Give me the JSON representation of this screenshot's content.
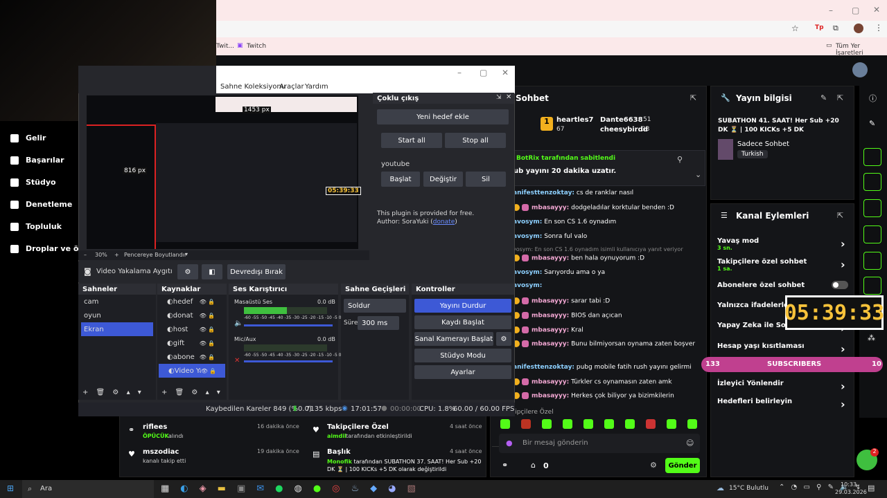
{
  "browser": {
    "tab_title": "Twitch",
    "bookmarks_folder": "Tüm Yer İşaretleri",
    "bookmark_prefix": "Twit..."
  },
  "nav": {
    "items": [
      {
        "label": "Gelir",
        "icon": "bar-chart-icon"
      },
      {
        "label": "Başarılar",
        "icon": "trophy-icon"
      },
      {
        "label": "Stüdyo",
        "icon": "studio-icon"
      },
      {
        "label": "Denetleme",
        "icon": "wrench-icon"
      },
      {
        "label": "Topluluk",
        "icon": "people-icon"
      },
      {
        "label": "Droplar ve ödül",
        "icon": "gift-icon"
      }
    ]
  },
  "obs": {
    "menu": [
      "Sahne Koleksiyonu",
      "Araçlar",
      "Yardım"
    ],
    "preview_px_label": "1453 px",
    "preview_px_label2": "816 px",
    "preview_timer": "05:39:33",
    "zoom": "30%",
    "resize_label": "Pencereye Boyutlandır",
    "source_label": "Video Yakalama Aygıtı",
    "deactivate_label": "Devredışı Bırak",
    "multi_output": {
      "title": "Çoklu çıkış",
      "add_target": "Yeni hedef ekle",
      "start_all": "Start all",
      "stop_all": "Stop all",
      "target_name": "youtube",
      "start": "Başlat",
      "edit": "Değiştir",
      "delete": "Sil",
      "free_note": "This plugin is provided for free.",
      "author": "Author: SoraYuki (",
      "donate": "donate",
      "author_end": ")"
    },
    "scenes": {
      "title": "Sahneler",
      "items": [
        "cam",
        "oyun",
        "Ekran"
      ]
    },
    "sources": {
      "title": "Kaynaklar",
      "items": [
        "hedef",
        "donat",
        "host",
        "gift",
        "abone",
        "Video Ya"
      ]
    },
    "mixer": {
      "title": "Ses Karıştırıcı",
      "ch1": "Masaüstü Ses",
      "ch1_db": "0.0 dB",
      "ch2": "Mic/Aux",
      "ch2_db": "0.0 dB",
      "scale": "-60 -55 -50 -45 -40 -35 -30 -25 -20 -15 -10 -5 0"
    },
    "transitions": {
      "title": "Sahne Geçişleri",
      "type": "Soldur",
      "duration_label": "Süre",
      "duration": "300 ms"
    },
    "controls": {
      "title": "Kontroller",
      "stop_stream": "Yayını Durdur",
      "start_record": "Kaydı Başlat",
      "virtual_cam": "Sanal Kamerayı Başlat",
      "studio_mode": "Stüdyo Modu",
      "settings": "Ayarlar"
    },
    "status": {
      "dropped": "Kaybedilen Kareler 849 (%0.0)",
      "bitrate": "7135 kbps",
      "live_time": "17:01:57",
      "rec_time": "00:00:00",
      "cpu": "CPU: 1.8%",
      "fps": "60.00 / 60.00 FPS"
    }
  },
  "chat": {
    "title": "Sohbet",
    "leaders": [
      {
        "name": "heartles7",
        "score": "67"
      },
      {
        "name": "Dante6638",
        "score": "51"
      },
      {
        "name": "cheesybirdd",
        "score": "33"
      }
    ],
    "pinned_by": "BotRix tarafından sabitlendi",
    "pinned_text": "ub yayını 20 dakika uzatır.",
    "lines": [
      {
        "user": "anifesttenzoktay:",
        "msg": " cs de ranklar nasıl",
        "kind": "a"
      },
      {
        "user": "mbasayyy:",
        "msg": " dodgeladılar korktular benden :D",
        "kind": "m"
      },
      {
        "user": "avosym:",
        "msg": " En son CS 1.6 oynadım",
        "kind": "a"
      },
      {
        "user": "avosym:",
        "msg": " Sonra ful valo",
        "kind": "a"
      },
      {
        "user": "",
        "msg": "vosym: En son CS 1.6 oynadım isimli kullanıcıya yanıt veriyor",
        "kind": "r"
      },
      {
        "user": "mbasayyy:",
        "msg": " ben hala oynuyorum :D",
        "kind": "m"
      },
      {
        "user": "avosym:",
        "msg": " Sarıyordu ama o ya",
        "kind": "a"
      },
      {
        "user": "avosym:",
        "msg": "",
        "kind": "a"
      },
      {
        "user": "mbasayyy:",
        "msg": " sarar tabi :D",
        "kind": "m"
      },
      {
        "user": "mbasayyy:",
        "msg": " BIOS dan açıcan",
        "kind": "m"
      },
      {
        "user": "mbasayyy:",
        "msg": " Kral",
        "kind": "m"
      },
      {
        "user": "mbasayyy:",
        "msg": " Bunu bilmiyorsan oynama zaten boşver",
        "kind": "m"
      },
      {
        "user": "anifesttenzoktay:",
        "msg": " pubg mobile fatih rush yayını gelirmi",
        "kind": "a"
      },
      {
        "user": "mbasayyy:",
        "msg": " Türkler cs oynamasın zaten amk",
        "kind": "m"
      },
      {
        "user": "mbasayyy:",
        "msg": " Herkes çok biliyor ya bizimkilerin",
        "kind": "m"
      }
    ],
    "followers_mode": "kipçilere Özel",
    "input_placeholder": "Bir mesaj gönderin",
    "points": "0",
    "send": "Gönder"
  },
  "stream_info": {
    "title": "Yayın bilgisi",
    "stream_title": "SUBATHON 41. SAAT! Her Sub +20 DK ⏳ | 100 KICKs +5 DK",
    "category": "Sadece Sohbet",
    "tag": "Turkish"
  },
  "channel_actions": {
    "title": "Kanal Eylemleri",
    "items": [
      {
        "label": "Yavaş mod",
        "sub": "3 sn."
      },
      {
        "label": "Takipçilere özel sohbet",
        "sub": "1 sa."
      },
      {
        "label": "Abonelere özel sohbet",
        "sub": ""
      },
      {
        "label": "Yalnızca ifadelerle sohbet",
        "sub": ""
      },
      {
        "label": "Yapay Zeka ile Sohbet",
        "sub": ""
      },
      {
        "label": "Hesap yaşı kısıtlaması",
        "sub": ""
      },
      {
        "label": "İzleyici Yönlendir",
        "sub": ""
      },
      {
        "label": "Hedefleri belirleyin",
        "sub": ""
      }
    ]
  },
  "overlay": {
    "timer": "05:39:33",
    "subs_left": "133",
    "subs_label": "SUBSCRIBERS",
    "subs_right": "10"
  },
  "activity": {
    "left": [
      {
        "user": "riflees",
        "time": "16 dakika önce",
        "detail_user": "ÖPÜCÜK",
        "detail": " alındı"
      },
      {
        "user": "mszodiac",
        "time": "19 dakika önce",
        "detail_user": "",
        "detail": "kanalı takip etti"
      }
    ],
    "right": [
      {
        "user": "Takipçilere Özel",
        "time": "4 saat önce",
        "detail_user": "aimdil",
        "detail": " tarafından etkinleştirildi"
      },
      {
        "user": "Başlık",
        "time": "4 saat önce",
        "detail_user": "Monofik",
        "detail": " tarafından SUBATHON 37. SAAT! Her Sub +20 DK ⏳ | 100 KICKs +5 DK olarak değiştirildi"
      }
    ]
  },
  "taskbar": {
    "search": "Ara",
    "weather": "15°C  Bulutlu",
    "time": "10:33",
    "date": "29.03.2026",
    "notif": "2"
  },
  "colors": {
    "kick_green": "#53fc18",
    "obs_blue": "#3d59d6",
    "accent_pink": "#c0408f"
  }
}
